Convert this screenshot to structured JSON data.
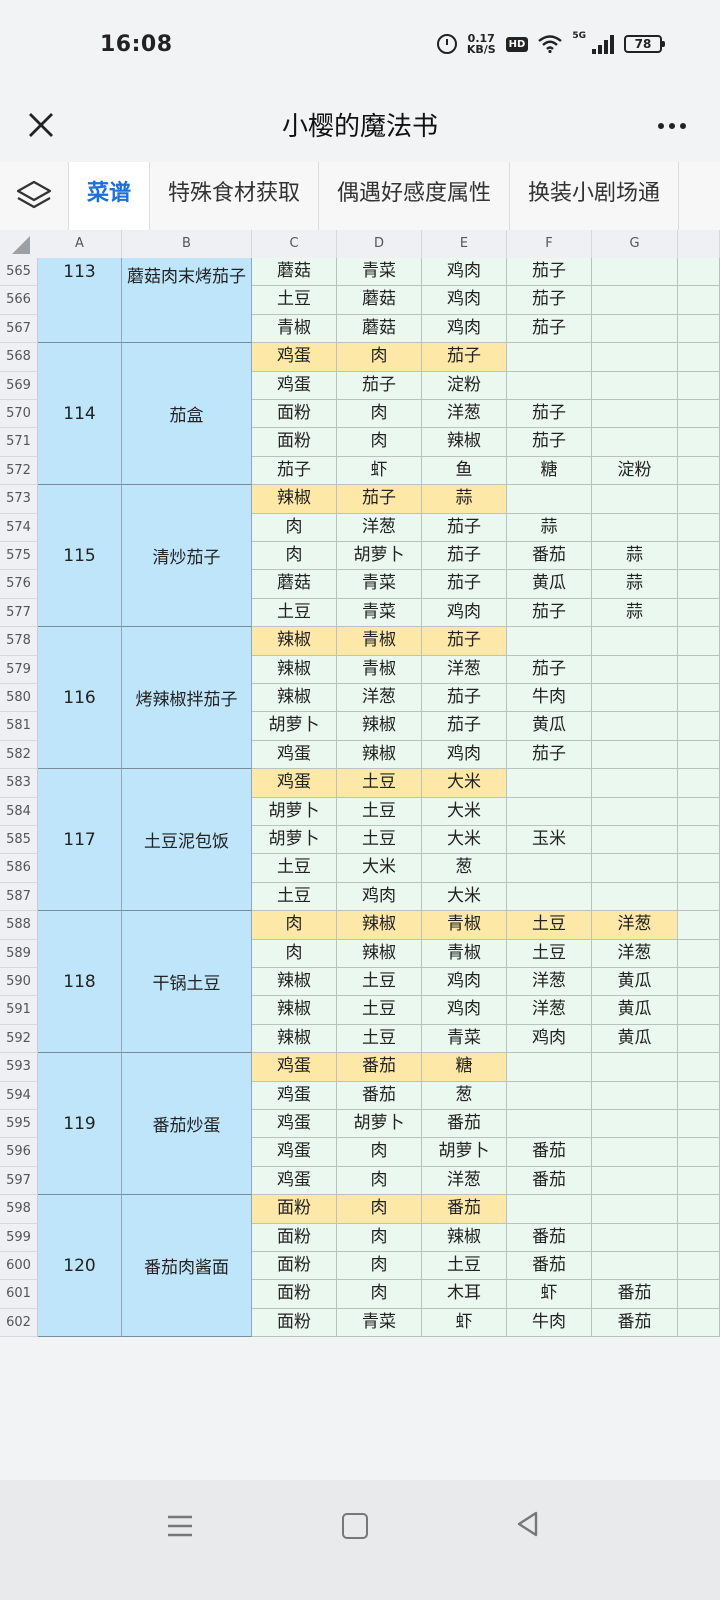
{
  "status": {
    "time": "16:08",
    "speed_value": "0.17",
    "speed_unit": "KB/S",
    "hd": "HD",
    "network": "5G",
    "battery": "78"
  },
  "titlebar": {
    "title": "小樱的魔法书"
  },
  "tabs": [
    "菜谱",
    "特殊食材获取",
    "偶遇好感度属性",
    "换装小剧场通"
  ],
  "columns": [
    "A",
    "B",
    "C",
    "D",
    "E",
    "F",
    "G"
  ],
  "colors": {
    "highlight": "#fde8a8",
    "cell": "#eaf8ef",
    "dish": "#bfe5fb",
    "active_tab": "#1e6fd9"
  },
  "recipes": [
    {
      "id": "113",
      "name": "蘑菇肉末烤茄子",
      "name_top": true,
      "start": 565,
      "highlight_first": false,
      "rows": [
        [
          "蘑菇",
          "青菜",
          "鸡肉",
          "茄子",
          ""
        ],
        [
          "土豆",
          "蘑菇",
          "鸡肉",
          "茄子",
          ""
        ],
        [
          "青椒",
          "蘑菇",
          "鸡肉",
          "茄子",
          ""
        ]
      ]
    },
    {
      "id": "114",
      "name": "茄盒",
      "start": 568,
      "highlight_first": true,
      "rows": [
        [
          "鸡蛋",
          "肉",
          "茄子",
          "",
          ""
        ],
        [
          "鸡蛋",
          "茄子",
          "淀粉",
          "",
          ""
        ],
        [
          "面粉",
          "肉",
          "洋葱",
          "茄子",
          ""
        ],
        [
          "面粉",
          "肉",
          "辣椒",
          "茄子",
          ""
        ],
        [
          "茄子",
          "虾",
          "鱼",
          "糖",
          "淀粉"
        ]
      ]
    },
    {
      "id": "115",
      "name": "清炒茄子",
      "start": 573,
      "highlight_first": true,
      "rows": [
        [
          "辣椒",
          "茄子",
          "蒜",
          "",
          ""
        ],
        [
          "肉",
          "洋葱",
          "茄子",
          "蒜",
          ""
        ],
        [
          "肉",
          "胡萝卜",
          "茄子",
          "番茄",
          "蒜"
        ],
        [
          "蘑菇",
          "青菜",
          "茄子",
          "黄瓜",
          "蒜"
        ],
        [
          "土豆",
          "青菜",
          "鸡肉",
          "茄子",
          "蒜"
        ]
      ]
    },
    {
      "id": "116",
      "name": "烤辣椒拌茄子",
      "start": 578,
      "highlight_first": true,
      "rows": [
        [
          "辣椒",
          "青椒",
          "茄子",
          "",
          ""
        ],
        [
          "辣椒",
          "青椒",
          "洋葱",
          "茄子",
          ""
        ],
        [
          "辣椒",
          "洋葱",
          "茄子",
          "牛肉",
          ""
        ],
        [
          "胡萝卜",
          "辣椒",
          "茄子",
          "黄瓜",
          ""
        ],
        [
          "鸡蛋",
          "辣椒",
          "鸡肉",
          "茄子",
          ""
        ]
      ]
    },
    {
      "id": "117",
      "name": "土豆泥包饭",
      "start": 583,
      "highlight_first": true,
      "rows": [
        [
          "鸡蛋",
          "土豆",
          "大米",
          "",
          ""
        ],
        [
          "胡萝卜",
          "土豆",
          "大米",
          "",
          ""
        ],
        [
          "胡萝卜",
          "土豆",
          "大米",
          "玉米",
          ""
        ],
        [
          "土豆",
          "大米",
          "葱",
          "",
          ""
        ],
        [
          "土豆",
          "鸡肉",
          "大米",
          "",
          ""
        ]
      ]
    },
    {
      "id": "118",
      "name": "干锅土豆",
      "start": 588,
      "highlight_first": true,
      "rows": [
        [
          "肉",
          "辣椒",
          "青椒",
          "土豆",
          "洋葱"
        ],
        [
          "肉",
          "辣椒",
          "青椒",
          "土豆",
          "洋葱"
        ],
        [
          "辣椒",
          "土豆",
          "鸡肉",
          "洋葱",
          "黄瓜"
        ],
        [
          "辣椒",
          "土豆",
          "鸡肉",
          "洋葱",
          "黄瓜"
        ],
        [
          "辣椒",
          "土豆",
          "青菜",
          "鸡肉",
          "黄瓜"
        ]
      ]
    },
    {
      "id": "119",
      "name": "番茄炒蛋",
      "start": 593,
      "highlight_first": true,
      "rows": [
        [
          "鸡蛋",
          "番茄",
          "糖",
          "",
          ""
        ],
        [
          "鸡蛋",
          "番茄",
          "葱",
          "",
          ""
        ],
        [
          "鸡蛋",
          "胡萝卜",
          "番茄",
          "",
          ""
        ],
        [
          "鸡蛋",
          "肉",
          "胡萝卜",
          "番茄",
          ""
        ],
        [
          "鸡蛋",
          "肉",
          "洋葱",
          "番茄",
          ""
        ]
      ]
    },
    {
      "id": "120",
      "name": "番茄肉酱面",
      "start": 598,
      "highlight_first": true,
      "rows": [
        [
          "面粉",
          "肉",
          "番茄",
          "",
          ""
        ],
        [
          "面粉",
          "肉",
          "辣椒",
          "番茄",
          ""
        ],
        [
          "面粉",
          "肉",
          "土豆",
          "番茄",
          ""
        ],
        [
          "面粉",
          "肉",
          "木耳",
          "虾",
          "番茄"
        ],
        [
          "面粉",
          "青菜",
          "虾",
          "牛肉",
          "番茄"
        ]
      ]
    }
  ]
}
